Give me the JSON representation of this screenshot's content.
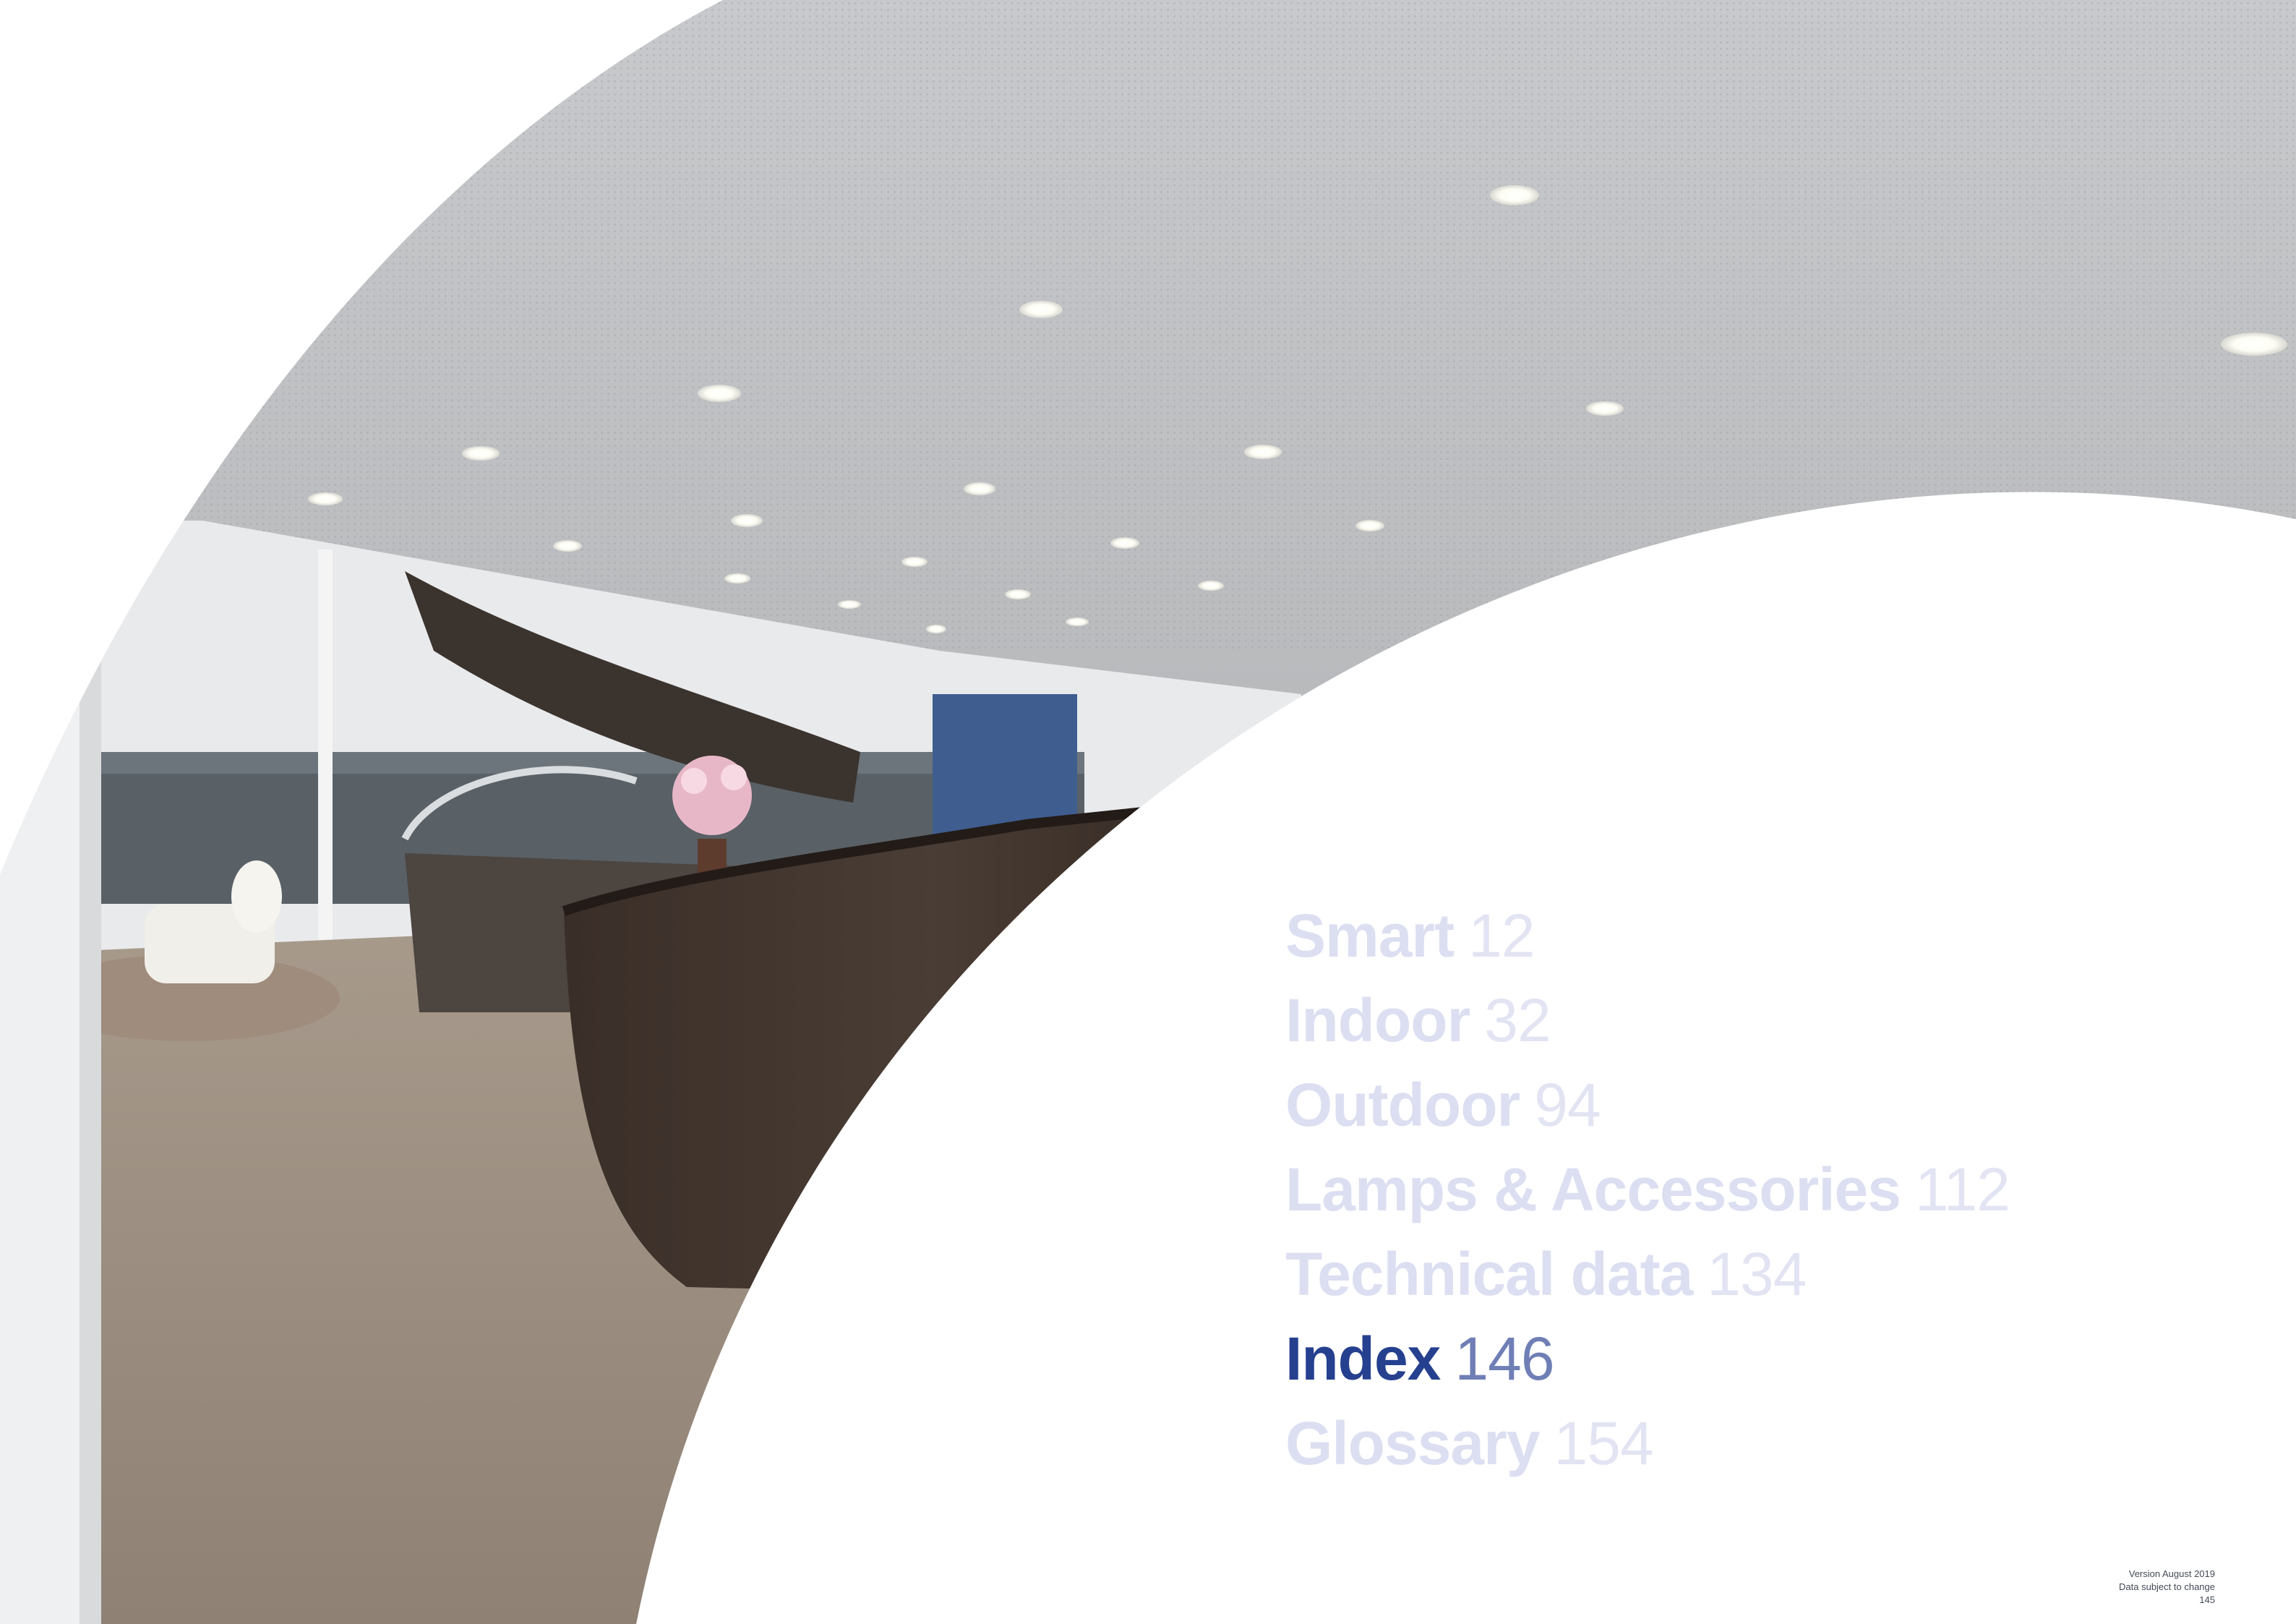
{
  "toc": {
    "items": [
      {
        "label": "Smart",
        "page": "12",
        "active": false
      },
      {
        "label": "Indoor",
        "page": "32",
        "active": false
      },
      {
        "label": "Outdoor",
        "page": "94",
        "active": false
      },
      {
        "label": "Lamps & Accessories",
        "page": "112",
        "active": false
      },
      {
        "label": "Technical data",
        "page": "134",
        "active": false
      },
      {
        "label": "Index",
        "page": "146",
        "active": true
      },
      {
        "label": "Glossary",
        "page": "154",
        "active": false
      }
    ],
    "colors": {
      "inactive": "#dcdff1",
      "active": "#25408f"
    }
  },
  "footer": {
    "version": "Version August 2019",
    "disclaimer": "Data subject to change",
    "page_number": "145"
  }
}
